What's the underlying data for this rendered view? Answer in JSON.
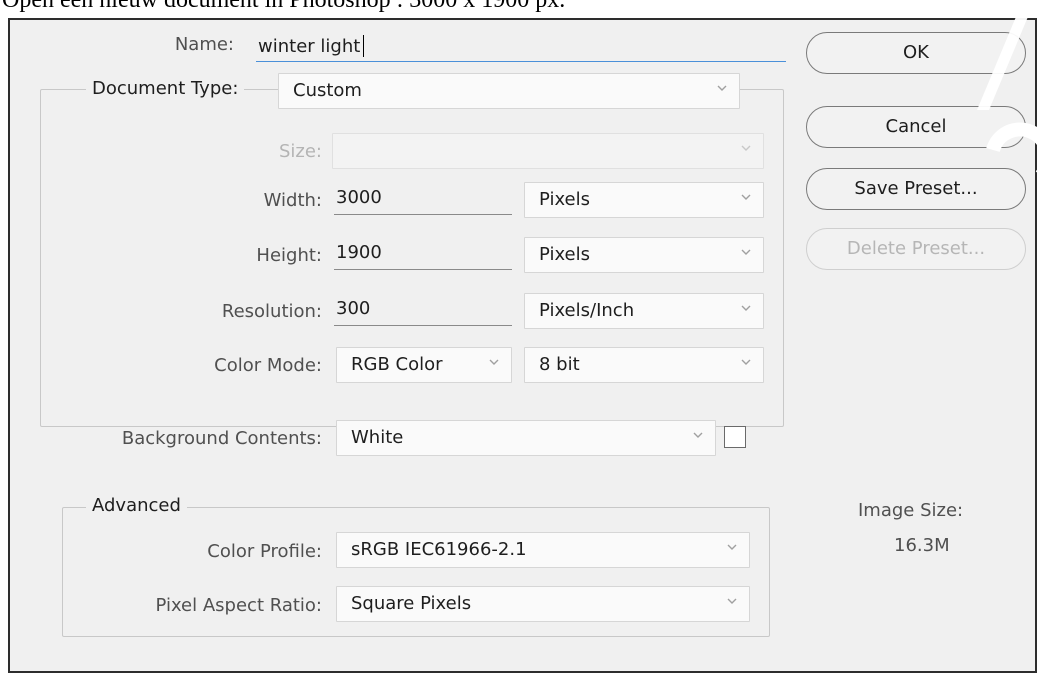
{
  "caption": "Open een nieuw document in Photoshop : 3000 x 1900 px.",
  "dialog": {
    "name_label": "Name:",
    "name_value": "winter light",
    "document_type": {
      "legend": "Document Type:",
      "value": "Custom",
      "size_label": "Size:",
      "size_value": "",
      "width_label": "Width:",
      "width_value": "3000",
      "width_unit": "Pixels",
      "height_label": "Height:",
      "height_value": "1900",
      "height_unit": "Pixels",
      "resolution_label": "Resolution:",
      "resolution_value": "300",
      "resolution_unit": "Pixels/Inch",
      "color_mode_label": "Color Mode:",
      "color_mode_value": "RGB Color",
      "bit_depth_value": "8 bit",
      "background_label": "Background Contents:",
      "background_value": "White",
      "background_swatch_color": "#ffffff"
    },
    "advanced": {
      "legend": "Advanced",
      "color_profile_label": "Color Profile:",
      "color_profile_value": "sRGB IEC61966-2.1",
      "pixel_aspect_label": "Pixel Aspect Ratio:",
      "pixel_aspect_value": "Square Pixels"
    },
    "buttons": {
      "ok": "OK",
      "cancel": "Cancel",
      "save_preset": "Save Preset...",
      "delete_preset": "Delete Preset..."
    },
    "image_size_label": "Image Size:",
    "image_size_value": "16.3M"
  },
  "colors": {
    "dialog_bg": "#f0f0f0",
    "focus_accent": "#4a90d9",
    "disabled_text": "#b4b4b4"
  }
}
